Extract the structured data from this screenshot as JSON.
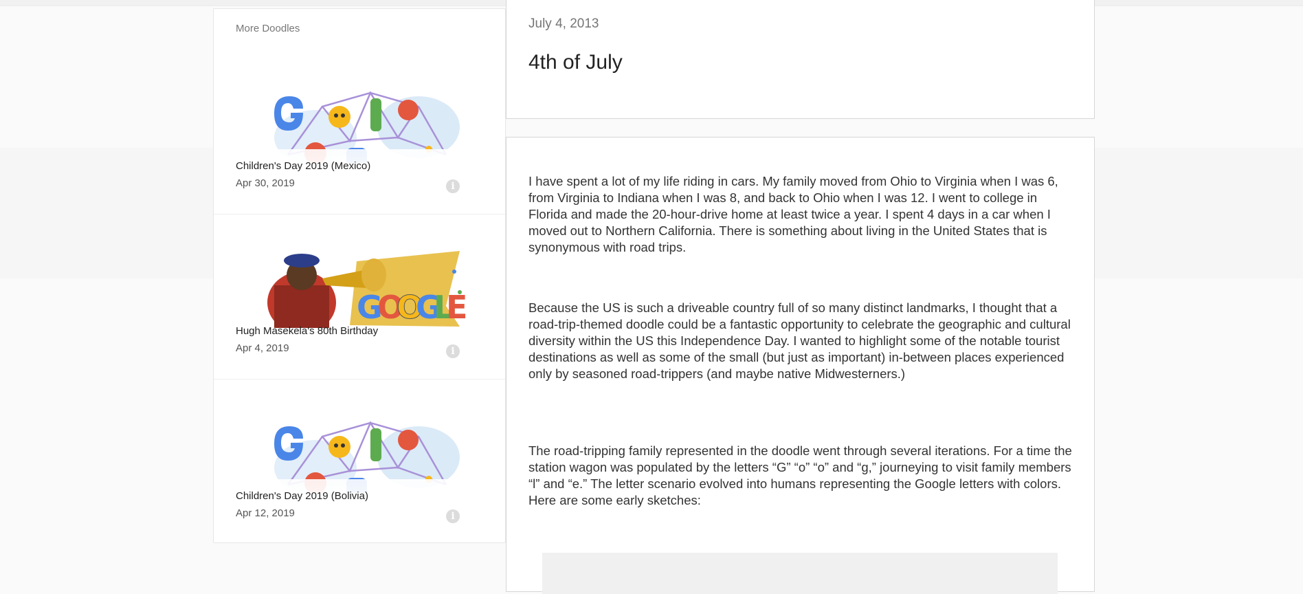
{
  "sidebar": {
    "title": "More Doodles",
    "cards": [
      {
        "title": "Children's Day 2019 (Mexico)",
        "date": "Apr 30, 2019",
        "icon": "info-icon"
      },
      {
        "title": "Hugh Masekela's 80th Birthday",
        "date": "Apr 4, 2019",
        "icon": "info-icon"
      },
      {
        "title": "Children's Day 2019 (Bolivia)",
        "date": "Apr 12, 2019",
        "icon": "info-icon"
      }
    ]
  },
  "post": {
    "date": "July 4, 2013",
    "title": "4th of July",
    "paragraphs": [
      "I have spent a lot of my life riding in cars.  My family moved from Ohio to Virginia when I was 6, from Virginia to Indiana when I was 8, and back to Ohio when I was 12.  I went to college in Florida and made the 20-hour-drive home at least twice a year.  I spent 4 days in a car when I moved out to Northern California.  There is something about living in the United States that is synonymous with road trips.",
      "Because the US is such a driveable country full of so many distinct landmarks, I thought that a road-trip-themed doodle could be a fantastic opportunity to celebrate the geographic and cultural diversity within the US this Independence Day.  I wanted to highlight some of the notable tourist destinations as well as some of the small (but just as important) in-between places experienced only by seasoned road-trippers (and maybe native Midwesterners.)",
      "The road-tripping family represented in the doodle went through several iterations.  For a time the station wagon was populated by the letters “G” “o” “o” and “g,” journeying to visit family members “l” and “e.”  The letter scenario evolved into humans representing the Google letters with colors.  Here are some early sketches:"
    ]
  }
}
